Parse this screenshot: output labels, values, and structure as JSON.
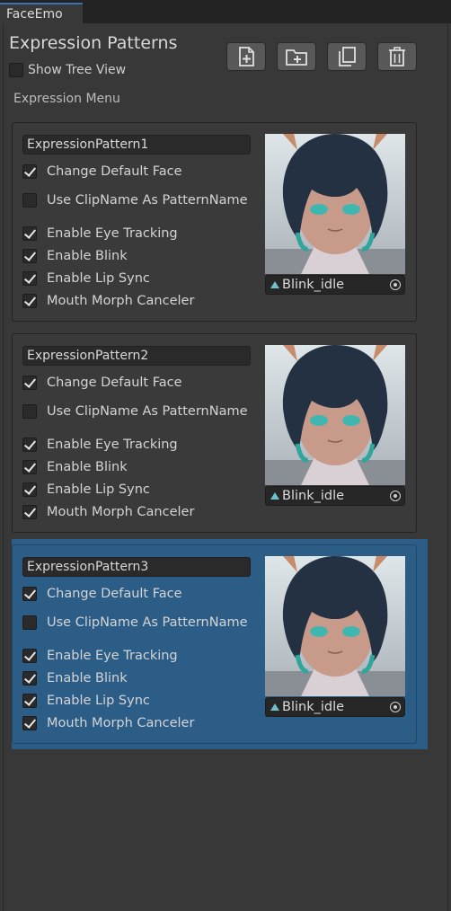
{
  "tab": {
    "title": "FaceEmo"
  },
  "header": {
    "title": "Expression Patterns",
    "show_tree_view": {
      "label": "Show Tree View",
      "checked": false
    },
    "menu_label": "Expression Menu",
    "toolbar": [
      {
        "name": "add-pattern-button",
        "icon": "new-file-icon"
      },
      {
        "name": "add-group-button",
        "icon": "new-folder-icon"
      },
      {
        "name": "copy-button",
        "icon": "copy-icon"
      },
      {
        "name": "delete-button",
        "icon": "trash-icon"
      }
    ]
  },
  "patterns": [
    {
      "name": "ExpressionPattern1",
      "selected": false,
      "options": {
        "change_default_face": {
          "label": "Change Default Face",
          "checked": true
        },
        "use_clipname": {
          "label": "Use ClipName As PatternName",
          "checked": false
        },
        "eye_tracking": {
          "label": "Enable Eye Tracking",
          "checked": true
        },
        "blink": {
          "label": "Enable Blink",
          "checked": true
        },
        "lip_sync": {
          "label": "Enable Lip Sync",
          "checked": true
        },
        "mouth_morph": {
          "label": "Mouth Morph Canceler",
          "checked": true
        }
      },
      "clip": "Blink_idle"
    },
    {
      "name": "ExpressionPattern2",
      "selected": false,
      "options": {
        "change_default_face": {
          "label": "Change Default Face",
          "checked": true
        },
        "use_clipname": {
          "label": "Use ClipName As PatternName",
          "checked": false
        },
        "eye_tracking": {
          "label": "Enable Eye Tracking",
          "checked": true
        },
        "blink": {
          "label": "Enable Blink",
          "checked": true
        },
        "lip_sync": {
          "label": "Enable Lip Sync",
          "checked": true
        },
        "mouth_morph": {
          "label": "Mouth Morph Canceler",
          "checked": true
        }
      },
      "clip": "Blink_idle"
    },
    {
      "name": "ExpressionPattern3",
      "selected": true,
      "options": {
        "change_default_face": {
          "label": "Change Default Face",
          "checked": true
        },
        "use_clipname": {
          "label": "Use ClipName As PatternName",
          "checked": false
        },
        "eye_tracking": {
          "label": "Enable Eye Tracking",
          "checked": true
        },
        "blink": {
          "label": "Enable Blink",
          "checked": true
        },
        "lip_sync": {
          "label": "Enable Lip Sync",
          "checked": true
        },
        "mouth_morph": {
          "label": "Mouth Morph Canceler",
          "checked": true
        }
      },
      "clip": "Blink_idle"
    }
  ],
  "colors": {
    "background": "#383838",
    "selected": "#2c5d87",
    "tab_accent": "#3a72b0"
  }
}
